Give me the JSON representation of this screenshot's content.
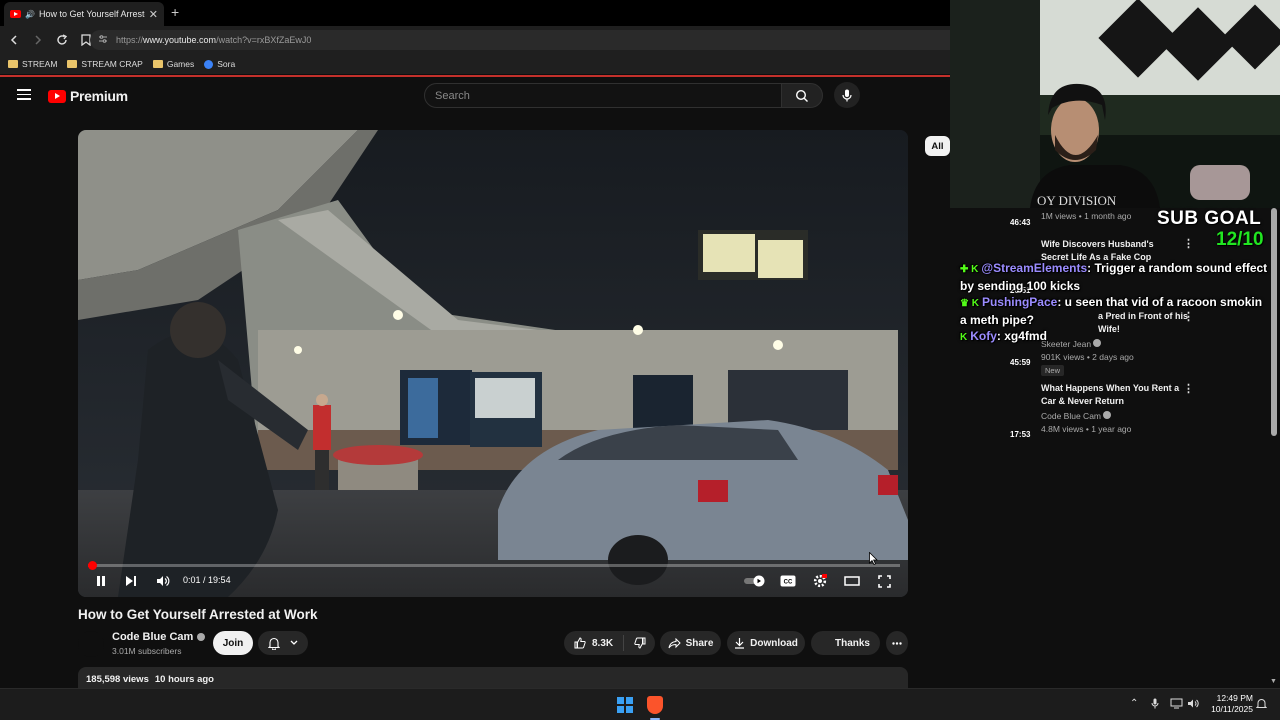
{
  "browser": {
    "tab_title": "How to Get Yourself Arrested at Work",
    "url_prefix": "https://",
    "url_host": "www.youtube.com",
    "url_path": "/watch?v=rxBXfZaEwJ0",
    "bookmarks": [
      "STREAM",
      "STREAM CRAP",
      "Games",
      "Sora"
    ]
  },
  "header": {
    "brand": "Premium",
    "search_placeholder": "Search"
  },
  "player": {
    "current_time": "0:01",
    "duration": "19:54",
    "progress_fraction": 0.001
  },
  "video": {
    "title": "How to Get Yourself Arrested at Work",
    "channel": "Code Blue Cam",
    "subscribers": "3.01M subscribers",
    "join_label": "Join",
    "likes": "8.3K",
    "share_label": "Share",
    "download_label": "Download",
    "thanks_label": "Thanks",
    "views": "185,598 views",
    "posted": "10 hours ago"
  },
  "sidebar": {
    "chip_all": "All",
    "items": [
      {
        "duration": "46:43",
        "title": "",
        "channel": "",
        "meta": "1M views • 1 month ago"
      },
      {
        "duration": "20:51",
        "title": "Wife Discovers Husband's Secret Life As a Fake Cop",
        "channel": "",
        "meta": ""
      },
      {
        "duration": "45:59",
        "title": "a Pred in Front of his Wife!",
        "channel": "Skeeter Jean",
        "meta": "901K views • 2 days ago",
        "badge": "New"
      },
      {
        "duration": "17:53",
        "title": "What Happens When You Rent a Car & Never Return",
        "channel": "Code Blue Cam",
        "meta": "4.8M views • 1 year ago"
      }
    ]
  },
  "overlay": {
    "sub_goal_label": "SUB GOAL",
    "sub_goal_count": "12/10",
    "chat": [
      {
        "user": "@StreamElements",
        "message": ": Trigger a random sound effect by sending 100 kicks"
      },
      {
        "user": "PushingPace",
        "message": ": u seen that vid of a racoon smokin a meth pipe?"
      },
      {
        "user": "Kofy",
        "message": ": xg4fmd"
      }
    ],
    "webcam_shirt_text": "OY DIVISION"
  },
  "taskbar": {
    "time": "12:49 PM",
    "date": "10/11/2025"
  }
}
